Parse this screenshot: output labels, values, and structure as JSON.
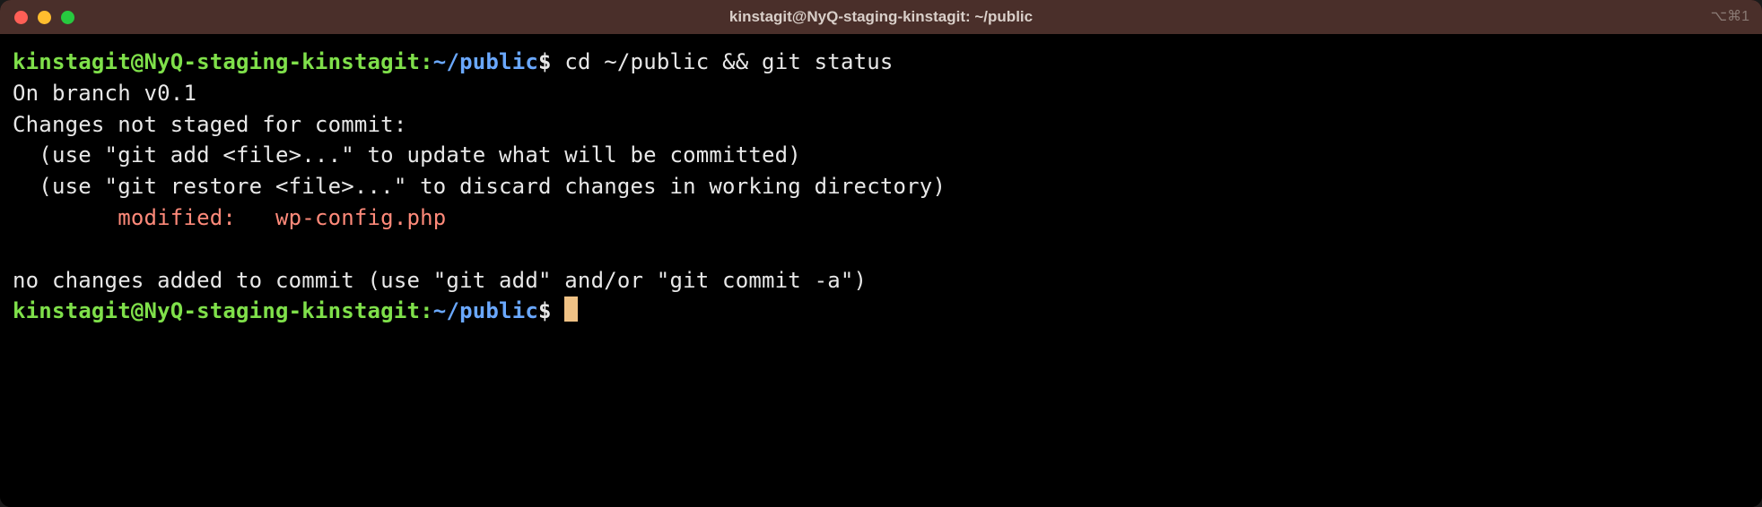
{
  "window": {
    "title": "kinstagit@NyQ-staging-kinstagit: ~/public",
    "shortcut": "⌥⌘1"
  },
  "prompt": {
    "user_host": "kinstagit@NyQ-staging-kinstagit",
    "sep": ":",
    "path": "~/public",
    "symbol": "$"
  },
  "command": "cd ~/public && git status",
  "output": {
    "l1": "On branch v0.1",
    "l2": "Changes not staged for commit:",
    "l3": "  (use \"git add <file>...\" to update what will be committed)",
    "l4": "  (use \"git restore <file>...\" to discard changes in working directory)",
    "l5_indent": "        ",
    "l5_mod": "modified:   wp-config.php",
    "l6": "",
    "l7": "no changes added to commit (use \"git add\" and/or \"git commit -a\")"
  }
}
